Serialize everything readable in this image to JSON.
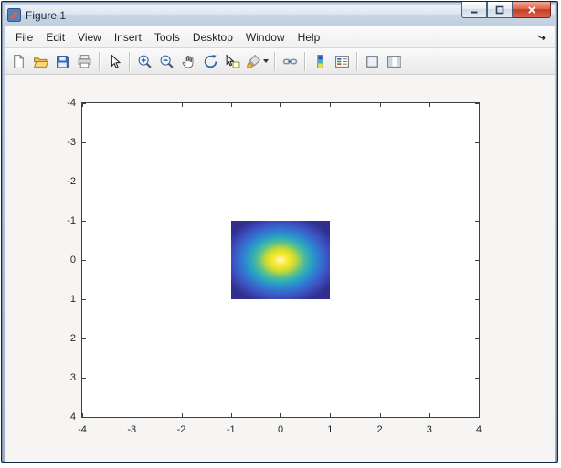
{
  "window": {
    "title": "Figure 1",
    "controls": [
      "minimize",
      "maximize",
      "close"
    ],
    "frame_color": "#14293f",
    "close_button_color": "#c53d22"
  },
  "menu": {
    "items": [
      "File",
      "Edit",
      "View",
      "Insert",
      "Tools",
      "Desktop",
      "Window",
      "Help"
    ],
    "pin_icon": "dock-arrow-icon"
  },
  "toolbar": {
    "buttons": [
      "new-figure-icon",
      "open-file-icon",
      "save-icon",
      "print-icon",
      "separator",
      "edit-plot-icon",
      "separator",
      "zoom-in-icon",
      "zoom-out-icon",
      "pan-icon",
      "rotate-3d-icon",
      "data-cursor-icon",
      "brush-icon",
      "separator",
      "link-plot-icon",
      "separator",
      "insert-colorbar-icon",
      "insert-legend-icon",
      "separator",
      "hide-plot-tools-icon",
      "show-plot-tools-icon"
    ]
  },
  "chart_data": {
    "type": "heatmap",
    "title": "",
    "xlabel": "",
    "ylabel": "",
    "x_range": [
      -4,
      4
    ],
    "y_range": [
      -4,
      4
    ],
    "y_direction": "reverse",
    "x_ticks": [
      -4,
      -3,
      -2,
      -1,
      0,
      1,
      2,
      3,
      4
    ],
    "y_ticks": [
      -4,
      -3,
      -2,
      -1,
      0,
      1,
      2,
      3,
      4
    ],
    "grid": false,
    "box": true,
    "image_extent": {
      "x": [
        -1,
        1
      ],
      "y": [
        -1,
        1
      ]
    },
    "image_description": "2D Gaussian intensity blob peaking at (0,0), bright yellow center fading radially to dark blue at the image edges",
    "colormap": "parula",
    "colormap_stops": [
      "#fcf9c4 0%",
      "#f8e92c 13%",
      "#c9db33 25%",
      "#5fc289 37%",
      "#2aa8bf 50%",
      "#2f7dd1 64%",
      "#3d53c3 80%",
      "#312f8d 100%"
    ],
    "axes_background": "#ffffff",
    "figure_background": "#f6f5f3"
  }
}
